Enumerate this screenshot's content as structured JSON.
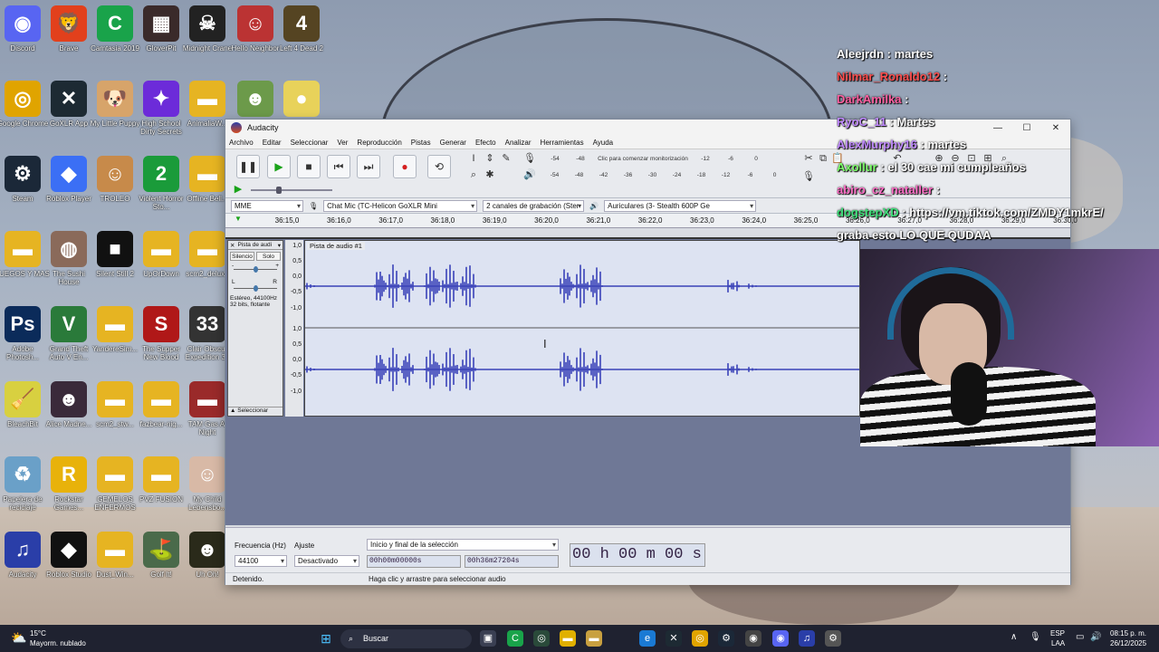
{
  "desktop": {
    "icons": [
      {
        "label": "Discord",
        "glyph": "◉",
        "color": "#5865f2",
        "col": 0,
        "row": 0
      },
      {
        "label": "Brave",
        "glyph": "🦁",
        "color": "#e2401c",
        "col": 1,
        "row": 0
      },
      {
        "label": "Camtasia 2019",
        "glyph": "C",
        "color": "#19a34a",
        "col": 2,
        "row": 0
      },
      {
        "label": "GloverPit",
        "glyph": "▦",
        "color": "#3a2a2a",
        "col": 3,
        "row": 0
      },
      {
        "label": "Midnight Crane",
        "glyph": "☠",
        "color": "#222",
        "col": 4,
        "row": 0
      },
      {
        "label": "Hello Neighbor",
        "glyph": "☺",
        "color": "#b33",
        "col": 5,
        "row": 0
      },
      {
        "label": "Left 4 Dead 2",
        "glyph": "4",
        "color": "#554422",
        "col": 6,
        "row": 0
      },
      {
        "label": "Google Chrome",
        "glyph": "◎",
        "color": "#e0a400",
        "col": 0,
        "row": 1
      },
      {
        "label": "GoXLR App",
        "glyph": "✕",
        "color": "#1d2a33",
        "col": 1,
        "row": 1
      },
      {
        "label": "My Little Puppy",
        "glyph": "🐶",
        "color": "#d7a46a",
        "col": 2,
        "row": 1
      },
      {
        "label": "High School Dirty Secrets",
        "glyph": "✦",
        "color": "#6c2bd9",
        "col": 3,
        "row": 1
      },
      {
        "label": "AnimaliaW...",
        "glyph": "▬",
        "color": "#e6b422",
        "col": 4,
        "row": 1
      },
      {
        "label": "",
        "glyph": "☻",
        "color": "#6c9a4a",
        "col": 5,
        "row": 1
      },
      {
        "label": "",
        "glyph": "●",
        "color": "#e8d25a",
        "col": 6,
        "row": 1
      },
      {
        "label": "Steam",
        "glyph": "⚙",
        "color": "#1b2838",
        "col": 0,
        "row": 2
      },
      {
        "label": "Roblox Player",
        "glyph": "◆",
        "color": "#3b6ff5",
        "col": 1,
        "row": 2
      },
      {
        "label": "TROLEO",
        "glyph": "☺",
        "color": "#c78a4a",
        "col": 2,
        "row": 2
      },
      {
        "label": "Violent Horror Sto...",
        "glyph": "2",
        "color": "#1a9b3a",
        "col": 3,
        "row": 2
      },
      {
        "label": "Offline Bell...",
        "glyph": "▬",
        "color": "#e6b422",
        "col": 4,
        "row": 2
      },
      {
        "label": "JUEGOS Y MAS",
        "glyph": "▬",
        "color": "#e6b422",
        "col": 0,
        "row": 3
      },
      {
        "label": "The Sushi House",
        "glyph": "◍",
        "color": "#8a6a5a",
        "col": 1,
        "row": 3
      },
      {
        "label": "Silent Still 2",
        "glyph": "■",
        "color": "#111",
        "col": 2,
        "row": 3
      },
      {
        "label": "UpOrDown",
        "glyph": "▬",
        "color": "#e6b422",
        "col": 3,
        "row": 3
      },
      {
        "label": "scm2_deluxe",
        "glyph": "▬",
        "color": "#e6b422",
        "col": 4,
        "row": 3
      },
      {
        "label": "Adobe Photosh...",
        "glyph": "Ps",
        "color": "#0b2b5a",
        "col": 0,
        "row": 4
      },
      {
        "label": "Grand Theft Auto V En...",
        "glyph": "V",
        "color": "#2a7a3a",
        "col": 1,
        "row": 4
      },
      {
        "label": "YandereSim...",
        "glyph": "▬",
        "color": "#e6b422",
        "col": 2,
        "row": 4
      },
      {
        "label": "The Supper New Blood",
        "glyph": "S",
        "color": "#b01818",
        "col": 3,
        "row": 4
      },
      {
        "label": "Clair Obscur Expedition 33",
        "glyph": "33",
        "color": "#333",
        "col": 4,
        "row": 4
      },
      {
        "label": "BleachBit",
        "glyph": "🧹",
        "color": "#d8d040",
        "col": 0,
        "row": 5
      },
      {
        "label": "Alice Madne...",
        "glyph": "☻",
        "color": "#3a2a3a",
        "col": 1,
        "row": 5
      },
      {
        "label": "scm2_stw...",
        "glyph": "▬",
        "color": "#e6b422",
        "col": 2,
        "row": 5
      },
      {
        "label": "fazbear-nig...",
        "glyph": "▬",
        "color": "#e6b422",
        "col": 3,
        "row": 5
      },
      {
        "label": "TAM Gas At Night",
        "glyph": "▬",
        "color": "#9a2a2a",
        "col": 4,
        "row": 5
      },
      {
        "label": "Papelera de reciclaje",
        "glyph": "♻",
        "color": "#6aa0c8",
        "col": 0,
        "row": 6
      },
      {
        "label": "Rockstar Games...",
        "glyph": "R",
        "color": "#e8b20a",
        "col": 1,
        "row": 6
      },
      {
        "label": "GEMELOS ENFERMOS",
        "glyph": "▬",
        "color": "#e6b422",
        "col": 2,
        "row": 6
      },
      {
        "label": "PVZ FUSION",
        "glyph": "▬",
        "color": "#e6b422",
        "col": 3,
        "row": 6
      },
      {
        "label": "My Child Lebensbo...",
        "glyph": "☺",
        "color": "#d8b9a6",
        "col": 4,
        "row": 6
      },
      {
        "label": "Audacity",
        "glyph": "♫",
        "color": "#2a3ea8",
        "col": 0,
        "row": 7
      },
      {
        "label": "Roblox Studio",
        "glyph": "◆",
        "color": "#111",
        "col": 1,
        "row": 7
      },
      {
        "label": "Dust_Win...",
        "glyph": "▬",
        "color": "#e6b422",
        "col": 2,
        "row": 7
      },
      {
        "label": "Golf It!",
        "glyph": "⛳",
        "color": "#4a6a4a",
        "col": 3,
        "row": 7
      },
      {
        "label": "Uh Oh!",
        "glyph": "☻",
        "color": "#2a2a1a",
        "col": 4,
        "row": 7
      }
    ]
  },
  "audacity": {
    "window_title": "Audacity",
    "menu": [
      "Archivo",
      "Editar",
      "Seleccionar",
      "Ver",
      "Reproducción",
      "Pistas",
      "Generar",
      "Efecto",
      "Analizar",
      "Herramientas",
      "Ayuda"
    ],
    "meter_scale_record": [
      "-54",
      "-48",
      "Clic para comenzar monitorización",
      "-12",
      "-6",
      "0"
    ],
    "meter_scale_play": [
      "-54",
      "-48",
      "-42",
      "-36",
      "-30",
      "-24",
      "-18",
      "-12",
      "-6",
      "0"
    ],
    "host": "MME",
    "record_device": "Chat Mic (TC-Helicon GoXLR Mini",
    "channels": "2 canales de grabación (Ster",
    "playback_device": "Auriculares (3- Stealth 600P Ge",
    "ruler_ticks": [
      "36:15,0",
      "36:16,0",
      "36:17,0",
      "36:18,0",
      "36:19,0",
      "36:20,0",
      "36:21,0",
      "36:22,0",
      "36:23,0",
      "36:24,0",
      "36:25,0",
      "36:26,0",
      "36:27,0",
      "36:28,0",
      "36:29,0",
      "36:30,0"
    ],
    "track": {
      "name": "Pista de audi",
      "clip_title": "Pista de audio #1",
      "mute": "Silencio",
      "solo": "Solo",
      "info1": "Estéreo, 44100Hz",
      "info2": "32 bits, flotante",
      "select": "Seleccionar",
      "scale": [
        "1,0",
        "0,5",
        "0,0",
        "-0,5",
        "-1,0"
      ],
      "scale2": [
        "1,0",
        "0,5",
        "0,0",
        "-0,5",
        "-1,0"
      ],
      "pan_left": "L",
      "pan_right": "R",
      "gain_minus": "-",
      "gain_plus": "+"
    },
    "bottom": {
      "rate_label": "Frecuencia (Hz)",
      "rate_value": "44100",
      "snap_label": "Ajuste",
      "snap_value": "Desactivado",
      "selection_label": "Inicio y final de la selección",
      "sel_start": "00h00m00000s",
      "sel_end": "00h36m27204s",
      "big_time": "00 h 00 m 00 s"
    },
    "status_left": "Detenido.",
    "status_right": "Haga clic y arrastre para seleccionar audio"
  },
  "chat": [
    {
      "user": "Aleejrdn",
      "msg": "martes",
      "color": "#ffffff"
    },
    {
      "user": "Nilmar_Ronaldo12",
      "msg": "",
      "color": "#ff4f4f"
    },
    {
      "user": "DarkAmilka",
      "msg": "",
      "color": "#ff5fa0"
    },
    {
      "user": "RyoC_11",
      "msg": "Martes",
      "color": "#c08aff"
    },
    {
      "user": "AlexMurphy16",
      "msg": "martes",
      "color": "#c08aff"
    },
    {
      "user": "Axollur",
      "msg": "el 30 cae mi cumpleaños",
      "color": "#7dff6a"
    },
    {
      "user": "abiro_cz_nataller",
      "msg": "",
      "color": "#ff6ec7"
    },
    {
      "user": "dogstepXD",
      "msg": "https://vm.tiktok.com/ZMDY1mkrE/",
      "color": "#3fe07a"
    },
    {
      "user": "",
      "msg": "graba esto LO QUE QUDAA",
      "color": "#ffffff"
    }
  ],
  "taskbar": {
    "weather_temp": "15°C",
    "weather_desc": "Mayorm. nublado",
    "search_placeholder": "Buscar",
    "lang1": "ESP",
    "lang2": "LAA",
    "time": "08:15 p. m.",
    "date": "26/12/2025"
  }
}
